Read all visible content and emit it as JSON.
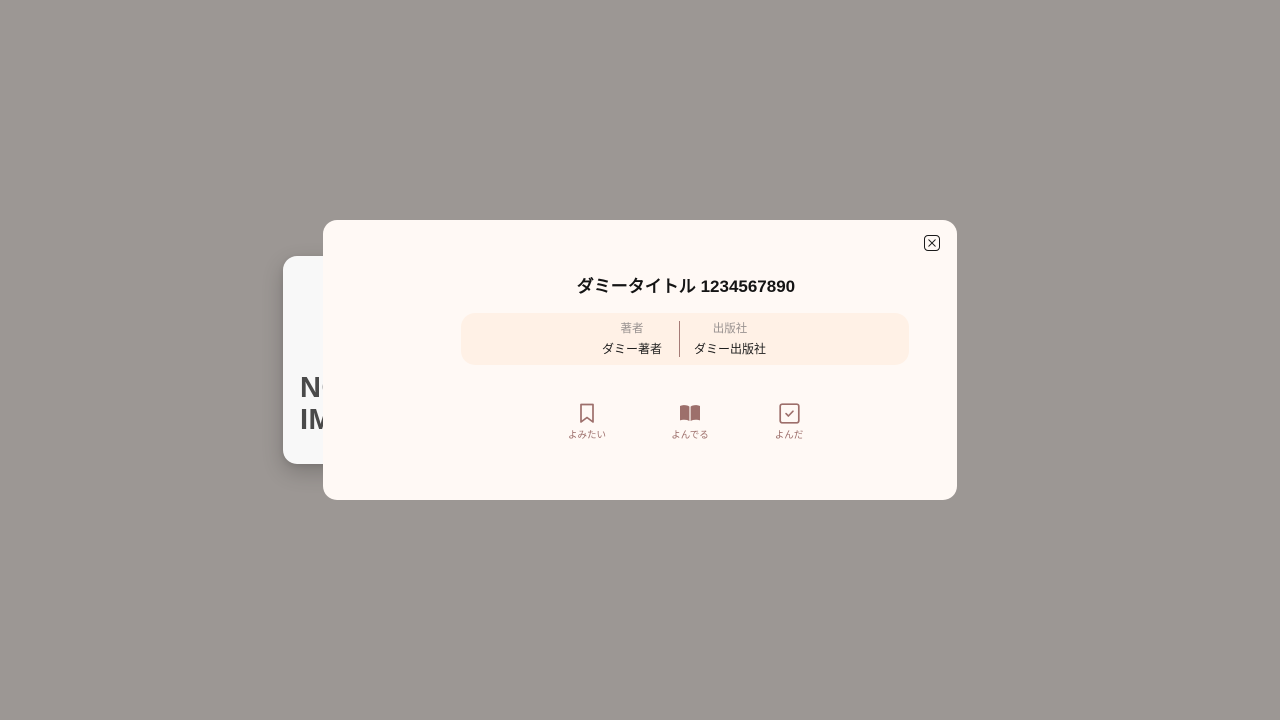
{
  "book": {
    "title": "ダミータイトル 1234567890",
    "cover_placeholder": "NO IMAGE",
    "author_label": "著者",
    "author_value": "ダミー著者",
    "publisher_label": "出版社",
    "publisher_value": "ダミー出版社"
  },
  "actions": {
    "want_to_read": {
      "label": "よみたい",
      "icon": "bookmark-icon"
    },
    "reading": {
      "label": "よんでる",
      "icon": "open-book-icon"
    },
    "read": {
      "label": "よんだ",
      "icon": "check-square-icon"
    }
  },
  "modal": {
    "close_icon": "close-icon"
  },
  "colors": {
    "overlay": "#9c9794",
    "modal_bg": "#fff9f5",
    "info_bg": "#fff1e6",
    "accent": "#9d6f6b",
    "cover_bg": "#f8f8f8"
  }
}
